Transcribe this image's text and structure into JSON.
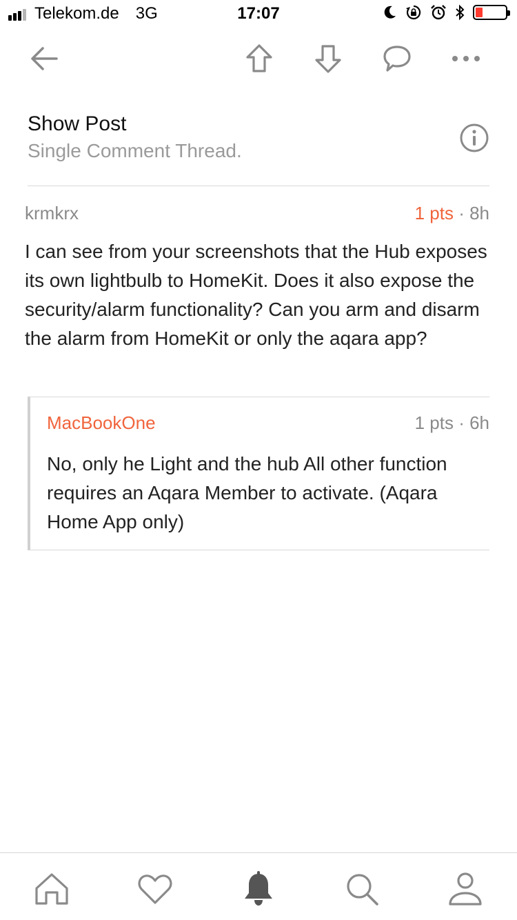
{
  "status_bar": {
    "carrier": "Telekom.de",
    "network": "3G",
    "time": "17:07",
    "battery_color": "#ff3b30",
    "icons": [
      "moon-icon",
      "rotation-lock-icon",
      "alarm-icon",
      "bluetooth-icon",
      "battery-icon"
    ]
  },
  "toolbar": {
    "icons": [
      "back-arrow-icon",
      "upvote-arrow-icon",
      "downvote-arrow-icon",
      "comment-bubble-icon",
      "more-dots-icon"
    ]
  },
  "header": {
    "title": "Show Post",
    "subtitle": "Single Comment Thread."
  },
  "comment": {
    "author": "krmkrx",
    "points": "1  pts",
    "separator": " · ",
    "age": "8h",
    "body": "I can see from your screenshots that the Hub exposes its own lightbulb to HomeKit. Does it also expose the security/alarm functionality? Can you arm and disarm the alarm from HomeKit or only the aqara app?"
  },
  "reply": {
    "author": "MacBookOne",
    "points": "1  pts",
    "separator": " · ",
    "age": "6h",
    "body": "No, only he Light and the hub All other function requires an Aqara Member to activate. (Aqara Home App only)"
  },
  "tab_bar": {
    "tabs": [
      "home-icon",
      "heart-icon",
      "bell-icon",
      "search-icon",
      "profile-icon"
    ],
    "active": "bell-icon"
  },
  "colors": {
    "accent": "#f0643c",
    "muted": "#8a8a8a",
    "icon": "#8a8a8a"
  }
}
